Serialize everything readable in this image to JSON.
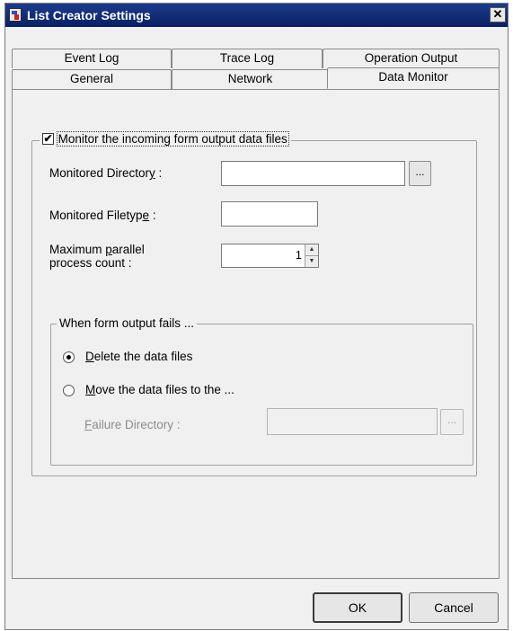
{
  "window": {
    "title": "List Creator Settings",
    "close_glyph": "✕"
  },
  "tabs": {
    "row1": [
      "Event Log",
      "Trace Log",
      "Operation Output"
    ],
    "row2": [
      "General",
      "Network",
      "Data Monitor"
    ],
    "active": "Data Monitor"
  },
  "monitor": {
    "checkbox_checked": true,
    "checkbox_glyph": "✔",
    "checkbox_label": "Monitor the incoming form output data files",
    "directory": {
      "label_pre": "Monitored Director",
      "label_accel": "y",
      "label_post": " :",
      "value": "",
      "browse_label": "..."
    },
    "filetype": {
      "label_pre": "Monitored Filetyp",
      "label_accel": "e",
      "label_post": " :",
      "value": ""
    },
    "parallel": {
      "label_line1_pre": "Maximum ",
      "label_line1_accel": "p",
      "label_line1_post": "arallel",
      "label_line2": "process count :",
      "value": "1",
      "up_glyph": "▲",
      "down_glyph": "▼"
    }
  },
  "failure": {
    "group_label": "When form output fails ...",
    "delete": {
      "accel": "D",
      "rest": "elete the data files",
      "checked": true
    },
    "move": {
      "accel": "M",
      "rest": "ove the data files to the ...",
      "checked": false
    },
    "directory": {
      "label_accel": "F",
      "label_rest": "ailure Directory :",
      "value": "",
      "browse_label": "..."
    }
  },
  "buttons": {
    "ok": "OK",
    "cancel": "Cancel"
  }
}
